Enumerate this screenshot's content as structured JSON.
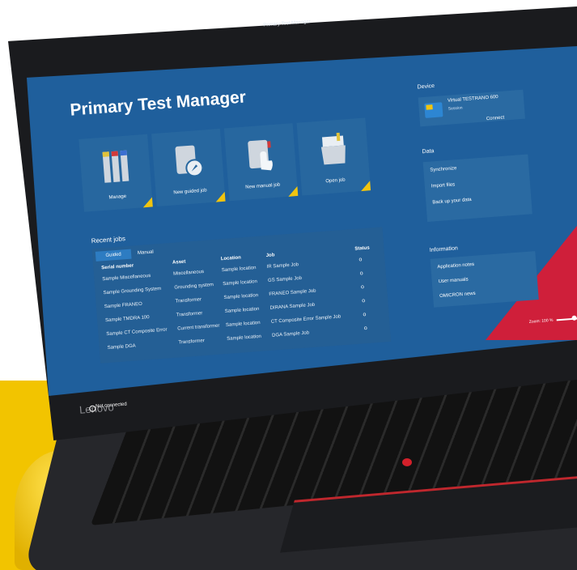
{
  "app": {
    "window_title": "Primary Test Manager",
    "page_title": "Primary Test Manager",
    "window_controls": "⚙ ? — □ ✕"
  },
  "tiles": [
    {
      "label": "Manage"
    },
    {
      "label": "New guided job"
    },
    {
      "label": "New manual job"
    },
    {
      "label": "Open job"
    }
  ],
  "recent": {
    "title": "Recent jobs",
    "tabs": [
      "Guided",
      "Manual"
    ],
    "columns": [
      "Serial number",
      "Asset",
      "Location",
      "Job",
      "Status"
    ],
    "rows": [
      [
        "Sample Miscellaneous",
        "Miscellaneous",
        "Sample location",
        "IR Sample Job"
      ],
      [
        "Sample Grounding System",
        "Grounding system",
        "Sample location",
        "GS Sample Job"
      ],
      [
        "Sample FRANEO",
        "Transformer",
        "Sample location",
        "FRANEO Sample Job"
      ],
      [
        "Sample TMDRA 100",
        "Transformer",
        "Sample location",
        "DIRANA Sample Job"
      ],
      [
        "Sample CT Composite Error",
        "Current transformer",
        "Sample location",
        "CT Composite Error Sample Job"
      ],
      [
        "Sample DGA",
        "Transformer",
        "Sample location",
        "DGA Sample Job"
      ]
    ]
  },
  "device": {
    "title": "Device",
    "name": "Virtual TESTRANO 600",
    "sub": "Session",
    "connect": "Connect"
  },
  "data_panel": {
    "title": "Data",
    "items": [
      "Synchronize",
      "Import files",
      "Back up your data"
    ]
  },
  "info_panel": {
    "title": "Information",
    "items": [
      "Application notes",
      "User manuals",
      "OMICRON news"
    ]
  },
  "zoom": {
    "label": "Zoom: 100 %",
    "level": 0.5
  },
  "status": {
    "connection": "Not connected"
  },
  "hardware": {
    "brand": "Lenovo"
  },
  "colors": {
    "screen_blue": "#1f5f9c",
    "accent_yellow": "#f1c40f",
    "accent_red": "#cf1f3a",
    "base_yellow": "#f2c400"
  }
}
